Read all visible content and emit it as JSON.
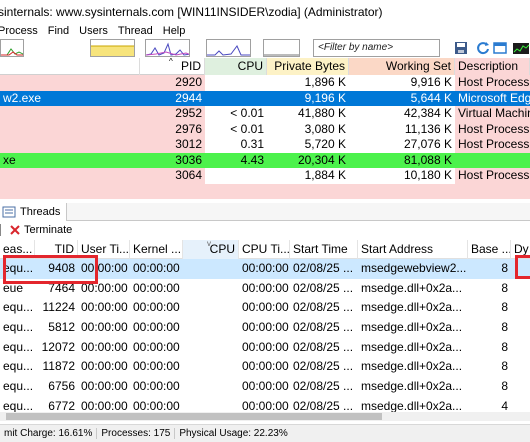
{
  "window": {
    "title": "sinternals: www.sysinternals.com [WIN11INSIDER\\zodia] (Administrator)"
  },
  "menu": [
    "Process",
    "Find",
    "Users",
    "Thread",
    "Help"
  ],
  "toolbar": {
    "filter_placeholder": "<Filter by name>"
  },
  "process_columns": [
    "PID",
    "CPU",
    "Private Bytes",
    "Working Set",
    "Description"
  ],
  "processes": [
    {
      "name": "",
      "pid": "2920",
      "cpu": "",
      "private": "1,896 K",
      "working": "9,916 K",
      "desc": "Host Process fo",
      "style": "pink"
    },
    {
      "name": "w2.exe",
      "pid": "2944",
      "cpu": "",
      "private": "9,196 K",
      "working": "5,644 K",
      "desc": "Microsoft Edge",
      "style": "selected"
    },
    {
      "name": "",
      "pid": "2952",
      "cpu": "< 0.01",
      "private": "41,880 K",
      "working": "42,384 K",
      "desc": "Virtual Machin",
      "style": "pink"
    },
    {
      "name": "",
      "pid": "2976",
      "cpu": "< 0.01",
      "private": "3,080 K",
      "working": "11,136 K",
      "desc": "Host Process fo",
      "style": "pink"
    },
    {
      "name": "",
      "pid": "3012",
      "cpu": "0.31",
      "private": "5,720 K",
      "working": "27,076 K",
      "desc": "Host Process fo",
      "style": "pink"
    },
    {
      "name": "xe",
      "pid": "3036",
      "cpu": "4.43",
      "private": "20,304 K",
      "working": "81,088 K",
      "desc": "",
      "style": "green"
    },
    {
      "name": "",
      "pid": "3064",
      "cpu": "",
      "private": "1,884 K",
      "working": "10,180 K",
      "desc": "Host Process fo",
      "style": "pink"
    }
  ],
  "threads_tab": {
    "label": "Threads"
  },
  "commands": {
    "terminate": "Terminate"
  },
  "thread_columns": [
    "eas...",
    "TID",
    "User Ti...",
    "Kernel ...",
    "CPU",
    "CPU Ti...",
    "Start Time",
    "Start Address",
    "Base ...",
    "Dy"
  ],
  "threads": [
    {
      "reason": "equ...",
      "tid": "9408",
      "user": "00:00:00",
      "kernel": "00:00:00",
      "cpu": "",
      "cputime": "00:00:00",
      "start": "02/08/25 ...",
      "address": "msedgewebview2...",
      "base": "8"
    },
    {
      "reason": "eue",
      "tid": "7464",
      "user": "00:00:00",
      "kernel": "00:00:00",
      "cpu": "",
      "cputime": "00:00:00",
      "start": "02/08/25 ...",
      "address": "msedge.dll+0x2a...",
      "base": "8"
    },
    {
      "reason": "equ...",
      "tid": "11224",
      "user": "00:00:00",
      "kernel": "00:00:00",
      "cpu": "",
      "cputime": "00:00:00",
      "start": "02/08/25 ...",
      "address": "msedge.dll+0x2a...",
      "base": "8"
    },
    {
      "reason": "equ...",
      "tid": "5812",
      "user": "00:00:00",
      "kernel": "00:00:00",
      "cpu": "",
      "cputime": "00:00:00",
      "start": "02/08/25 ...",
      "address": "msedge.dll+0x2a...",
      "base": "8"
    },
    {
      "reason": "equ...",
      "tid": "12072",
      "user": "00:00:00",
      "kernel": "00:00:00",
      "cpu": "",
      "cputime": "00:00:00",
      "start": "02/08/25 ...",
      "address": "msedge.dll+0x2a...",
      "base": "8"
    },
    {
      "reason": "equ...",
      "tid": "11872",
      "user": "00:00:00",
      "kernel": "00:00:00",
      "cpu": "",
      "cputime": "00:00:00",
      "start": "02/08/25 ...",
      "address": "msedge.dll+0x2a...",
      "base": "8"
    },
    {
      "reason": "equ...",
      "tid": "6756",
      "user": "00:00:00",
      "kernel": "00:00:00",
      "cpu": "",
      "cputime": "00:00:00",
      "start": "02/08/25 ...",
      "address": "msedge.dll+0x2a...",
      "base": "8"
    },
    {
      "reason": "equ...",
      "tid": "6772",
      "user": "00:00:00",
      "kernel": "00:00:00",
      "cpu": "",
      "cputime": "00:00:00",
      "start": "02/08/25 ...",
      "address": "msedge.dll+0x2a...",
      "base": "4"
    }
  ],
  "status": {
    "commit": "mit Charge: 16.61%",
    "processes": "Processes: 175",
    "physical": "Physical Usage: 22.23%"
  },
  "colors": {
    "service_pink": "#fbd6d6",
    "selected_blue": "#0078d7",
    "new_process_green": "#4cf24c",
    "cpu_col_bg": "#dff0df",
    "private_col_bg": "#fdf2c6",
    "working_col_bg": "#fbd8c6",
    "desc_col_bg": "#fbd6d6",
    "highlight_red": "#e3262d"
  },
  "icons": [
    "save-icon",
    "refresh-icon",
    "window-icon",
    "cpu-graph-icon",
    "terminate-icon",
    "threads-icon",
    "sort-arrow-icon"
  ]
}
